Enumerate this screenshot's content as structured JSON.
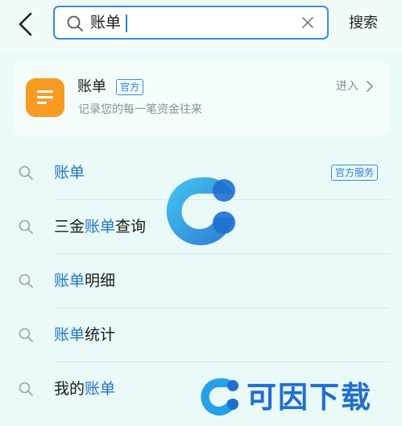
{
  "search": {
    "query": "账单",
    "submit_label": "搜索"
  },
  "official_card": {
    "title": "账单",
    "badge": "官方",
    "description": "记录您的每一笔资金往来",
    "enter_label": "进入",
    "icon_color": "#f79b22"
  },
  "suggestions": [
    {
      "before": "",
      "highlight": "账单",
      "after": "",
      "tag": "官方服务"
    },
    {
      "before": "三金",
      "highlight": "账单",
      "after": "查询",
      "tag": ""
    },
    {
      "before": "",
      "highlight": "账单",
      "after": "明细",
      "tag": ""
    },
    {
      "before": "",
      "highlight": "账单",
      "after": "统计",
      "tag": ""
    },
    {
      "before": "我的",
      "highlight": "账单",
      "after": "",
      "tag": ""
    }
  ],
  "watermark": {
    "text": "可因下载"
  },
  "colors": {
    "accent": "#2f7fd6",
    "highlight_text": "#2274c7",
    "background": "#eafaf8"
  }
}
